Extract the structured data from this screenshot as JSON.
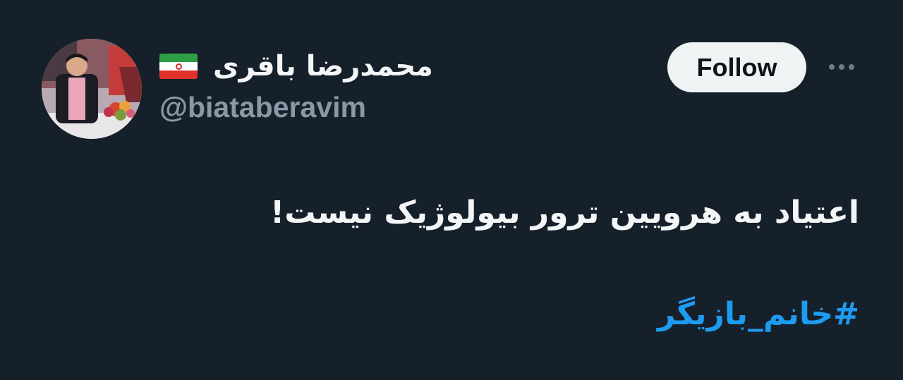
{
  "user": {
    "display_name": "محمدرضا باقری",
    "handle": "@biataberavim",
    "flag_icon": "iran-flag-icon"
  },
  "actions": {
    "follow_label": "Follow",
    "more_icon": "more-options-icon"
  },
  "tweet": {
    "text": "اعتیاد به هرویین ترور بیولوژیک نیست!",
    "hashtag": "#خانم_بازیگر"
  },
  "colors": {
    "background": "#16202b",
    "hashtag": "#1d9bf0",
    "follow_button_bg": "#eff3f4",
    "handle_text": "#8899a6"
  }
}
